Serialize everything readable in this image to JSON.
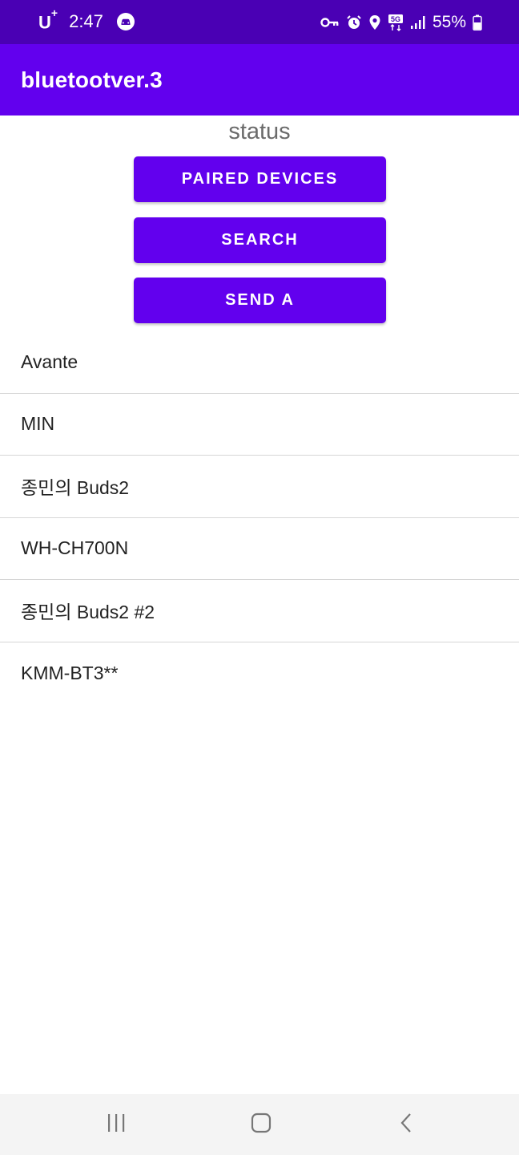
{
  "status_bar": {
    "carrier": "U",
    "carrier_plus": "+",
    "time": "2:47",
    "battery": "55%",
    "icons": [
      "car-icon",
      "key-icon",
      "alarm-icon",
      "location-icon",
      "5g-icon",
      "signal-icon",
      "battery-icon"
    ]
  },
  "app_bar": {
    "title": "bluetootver.3"
  },
  "main": {
    "status_text": "status",
    "buttons": {
      "paired": "PAIRED DEVICES",
      "search": "SEARCH",
      "send": "SEND A"
    },
    "devices": [
      "Avante",
      "MIN",
      "종민의 Buds2",
      "WH-CH700N",
      "종민의 Buds2 #2",
      "KMM-BT3**"
    ]
  },
  "nav_bar": {
    "icons": [
      "recents-icon",
      "home-icon",
      "back-icon"
    ]
  },
  "colors": {
    "status_bar": "#4a00b4",
    "primary": "#6200ee",
    "nav_bar": "#f4f4f4"
  }
}
